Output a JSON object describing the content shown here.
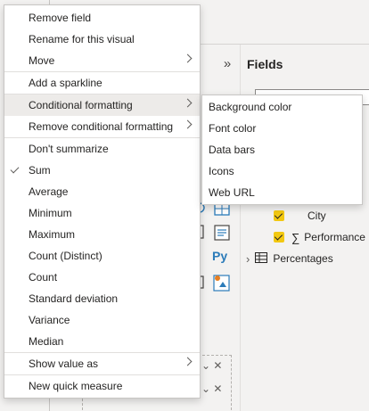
{
  "viz_pane": {
    "expand_glyph": "»",
    "well_controls": [
      "⌄ ✕",
      "⌄ ✕"
    ]
  },
  "fields_pane": {
    "title": "Fields",
    "items": [
      {
        "label": "City",
        "checked": true,
        "icon": ""
      },
      {
        "label": "Performance",
        "checked": true,
        "icon": "sum-icon",
        "icon_glyph": "∑"
      },
      {
        "label": "Percentages",
        "checked": false,
        "icon": "table-icon",
        "expander": "›"
      }
    ]
  },
  "viz_icons": [
    "python-icon",
    "table-viz-icon",
    "doc-viz-icon",
    "shape-map-icon"
  ],
  "viz_icon_text": {
    "python": "Py"
  },
  "context_menu": {
    "items": [
      {
        "label": "Remove field"
      },
      {
        "label": "Rename for this visual"
      },
      {
        "label": "Move",
        "submenu": true
      },
      {
        "label": "Add a sparkline"
      },
      {
        "label": "Conditional formatting",
        "submenu": true,
        "highlighted": true
      },
      {
        "label": "Remove conditional formatting",
        "submenu": true
      },
      {
        "label": "Don't summarize"
      },
      {
        "label": "Sum",
        "checked": true
      },
      {
        "label": "Average"
      },
      {
        "label": "Minimum"
      },
      {
        "label": "Maximum"
      },
      {
        "label": "Count (Distinct)"
      },
      {
        "label": "Count"
      },
      {
        "label": "Standard deviation"
      },
      {
        "label": "Variance"
      },
      {
        "label": "Median"
      },
      {
        "label": "Show value as",
        "submenu": true
      },
      {
        "label": "New quick measure"
      }
    ]
  },
  "conditional_formatting_submenu": {
    "items": [
      {
        "label": "Background color"
      },
      {
        "label": "Font color"
      },
      {
        "label": "Data bars"
      },
      {
        "label": "Icons"
      },
      {
        "label": "Web URL"
      }
    ]
  },
  "colors": {
    "accent_yellow": "#f2c811",
    "highlight": "#edebe9",
    "python_blue": "#2b7bb9"
  }
}
